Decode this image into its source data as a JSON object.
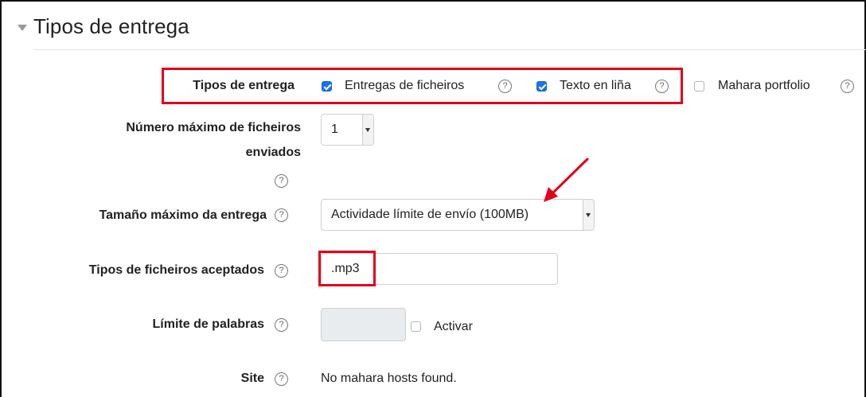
{
  "section": {
    "title": "Tipos de entrega"
  },
  "fields": {
    "submission_types": {
      "label": "Tipos de entrega",
      "options": [
        {
          "label": "Entregas de ficheiros",
          "checked": true
        },
        {
          "label": "Texto en liña",
          "checked": true
        },
        {
          "label": "Mahara portfolio",
          "checked": false
        }
      ]
    },
    "max_files": {
      "label_line1": "Número máximo de ficheiros",
      "label_line2": "enviados",
      "value": "1"
    },
    "max_size": {
      "label": "Tamaño máximo da entrega",
      "value": "Actividade límite de envío (100MB)"
    },
    "accepted_types": {
      "label": "Tipos de ficheiros aceptados",
      "value": ".mp3"
    },
    "word_limit": {
      "label": "Límite de palabras",
      "value": "",
      "enable_label": "Activar",
      "enabled": false
    },
    "site": {
      "label": "Site",
      "value": "No mahara hosts found."
    }
  },
  "help_glyph": "?",
  "colors": {
    "accent": "#1a73e8",
    "annotation": "#e2001a"
  }
}
